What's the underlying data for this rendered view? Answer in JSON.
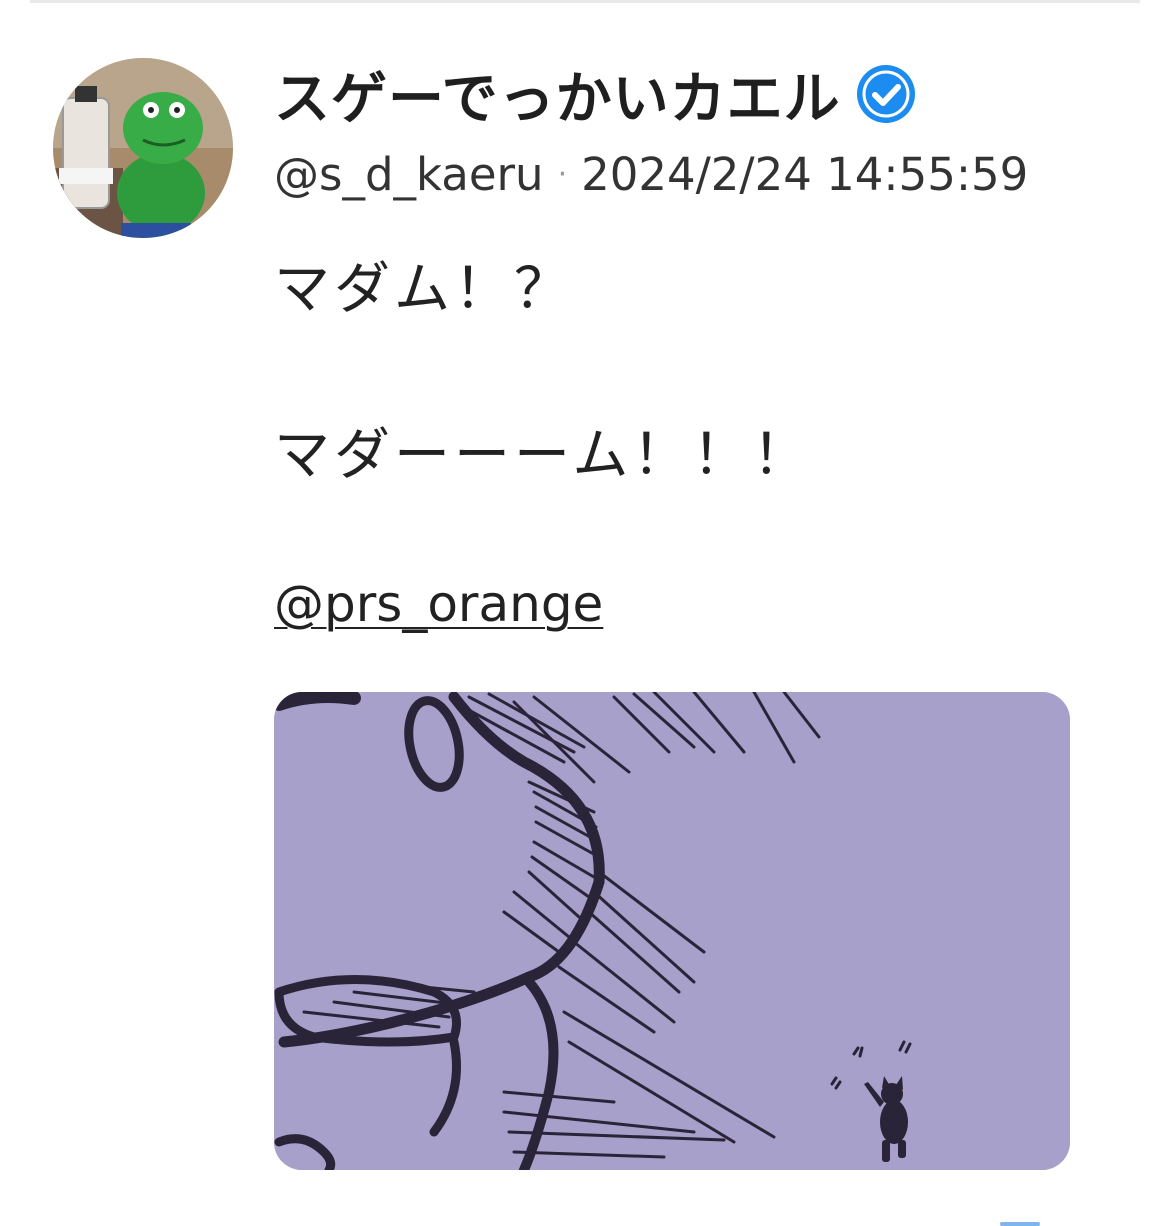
{
  "post": {
    "author": {
      "display_name": "スゲーでっかいカエル",
      "handle": "@s_d_kaeru",
      "verified": true,
      "avatar_icon": "frog-figure-avatar"
    },
    "meta_separator": "·",
    "timestamp": "2024/2/24 14:55:59",
    "body": {
      "line1": "マダム！？",
      "line2": "マダーーーム！！！",
      "mention": "@prs_orange"
    },
    "media": {
      "type": "illustration",
      "background_color": "#a6a0ca"
    }
  },
  "colors": {
    "verified_badge": "#1d8cf0",
    "text": "#1f1f1f"
  }
}
